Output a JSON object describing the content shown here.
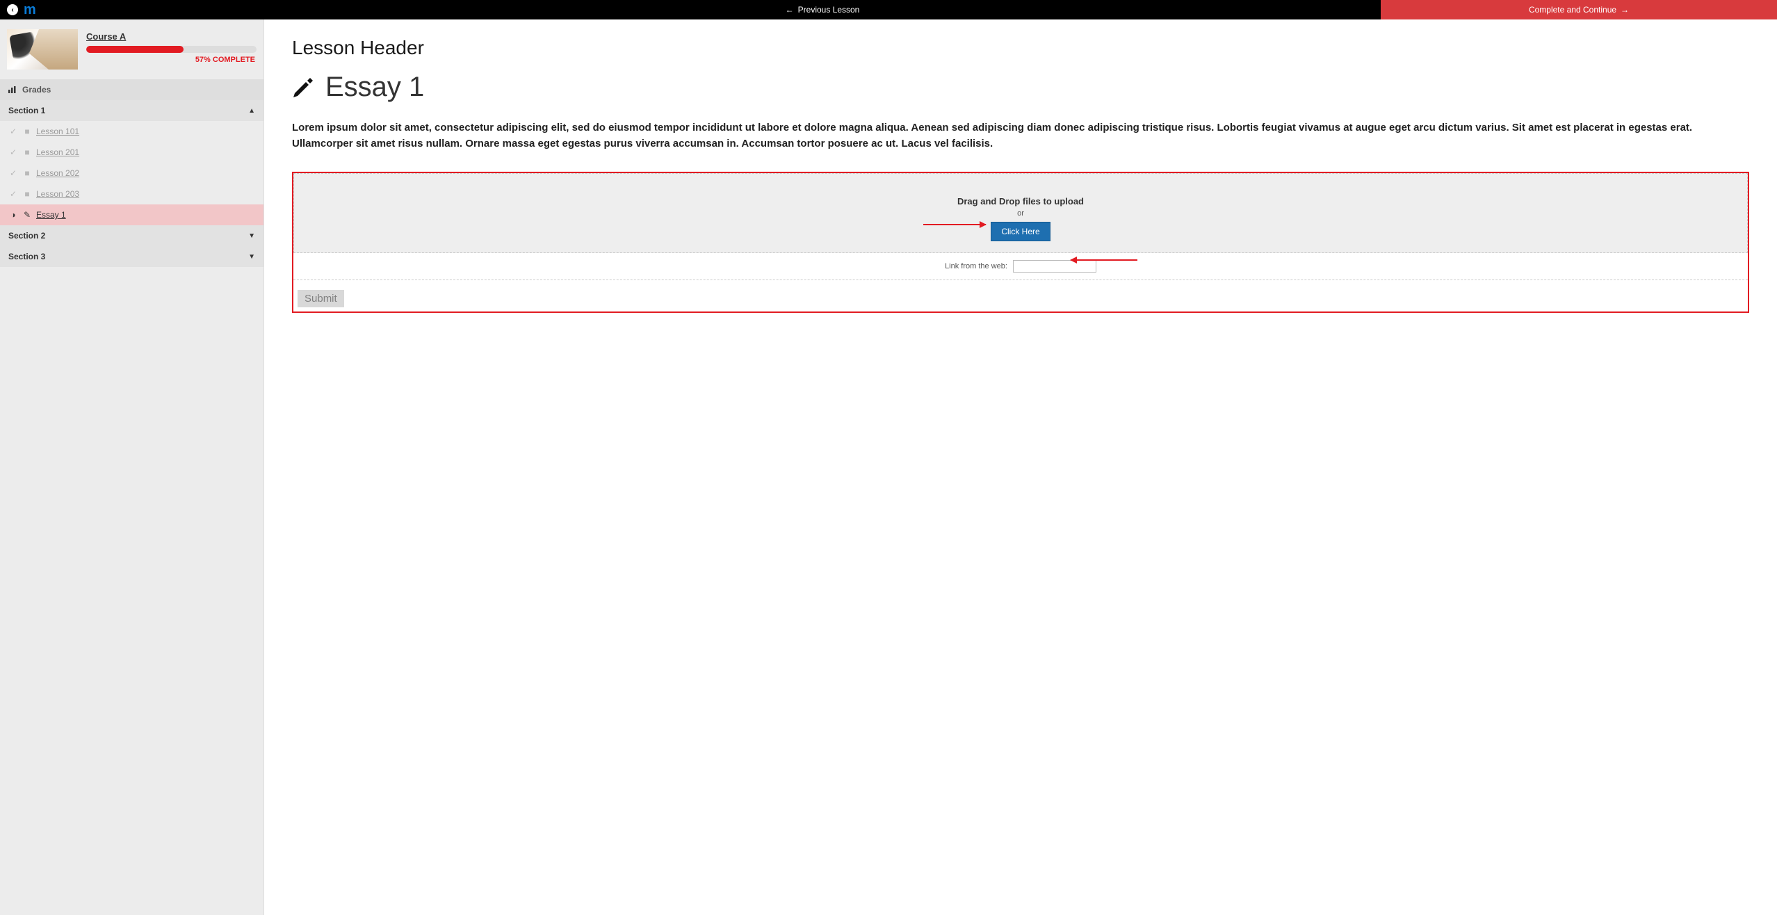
{
  "topbar": {
    "prev_label": "Previous Lesson",
    "next_label": "Complete and Continue"
  },
  "course": {
    "title": "Course A",
    "progress_pct": 57,
    "progress_label": "57% COMPLETE"
  },
  "sidebar": {
    "grades_label": "Grades",
    "sections": [
      {
        "title": "Section 1",
        "expanded": true,
        "items": [
          {
            "label": "Lesson 101",
            "type": "doc",
            "status": "done",
            "active": false
          },
          {
            "label": "Lesson 201",
            "type": "doc",
            "status": "done",
            "active": false
          },
          {
            "label": "Lesson 202",
            "type": "doc",
            "status": "done",
            "active": false
          },
          {
            "label": "Lesson 203",
            "type": "doc",
            "status": "done",
            "active": false
          },
          {
            "label": "Essay 1",
            "type": "essay",
            "status": "current",
            "active": true
          }
        ]
      },
      {
        "title": "Section 2",
        "expanded": false,
        "items": []
      },
      {
        "title": "Section 3",
        "expanded": false,
        "items": []
      }
    ]
  },
  "main": {
    "lesson_header": "Lesson Header",
    "essay_title": "Essay 1",
    "body": "Lorem ipsum dolor sit amet, consectetur adipiscing elit, sed do eiusmod tempor incididunt ut labore et dolore magna aliqua. Aenean sed adipiscing diam donec adipiscing tristique risus. Lobortis feugiat vivamus at augue eget arcu dictum varius. Sit amet est placerat in egestas erat. Ullamcorper sit amet risus nullam. Ornare massa eget egestas purus viverra accumsan in. Accumsan tortor posuere ac ut. Lacus vel facilisis.",
    "upload": {
      "drop_title": "Drag and Drop files to upload",
      "or": "or",
      "click_here": "Click Here",
      "link_label": "Link from the web:",
      "link_value": "",
      "submit": "Submit"
    }
  },
  "colors": {
    "accent_red": "#e21b22",
    "btn_blue": "#1e6fb0"
  }
}
